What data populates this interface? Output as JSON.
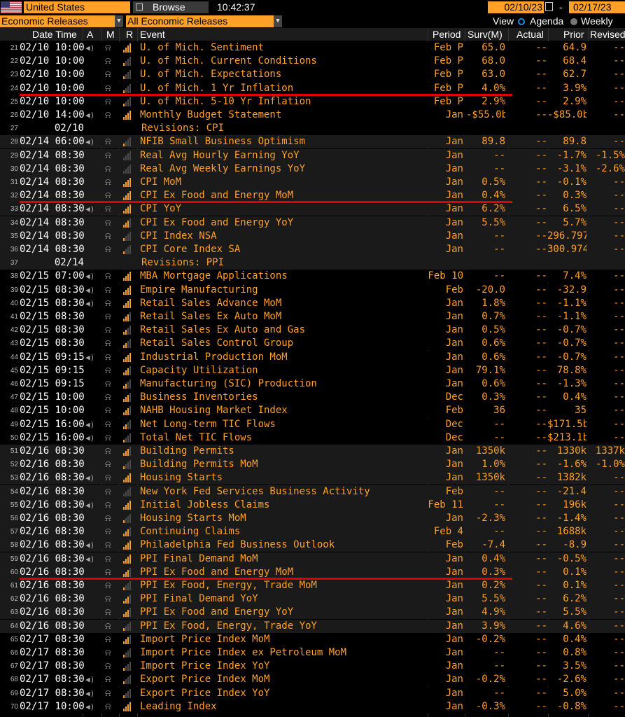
{
  "topbar": {
    "country": "United States",
    "browse_label": "Browse",
    "clock": "10:42:37",
    "start_date": "02/10/23",
    "dash": "-",
    "end_date": "02/17/23"
  },
  "filters": {
    "category": "Economic Releases",
    "releases": "All Economic Releases",
    "view_label": "View",
    "agenda_label": "Agenda",
    "weekly_label": "Weekly"
  },
  "columns": {
    "datetime": "Date Time",
    "a": "A",
    "m": "M",
    "r": "R",
    "event": "Event",
    "period": "Period",
    "surv": "Surv(M)",
    "actual": "Actual",
    "prior": "Prior",
    "revised": "Revised"
  },
  "colors": {
    "accent": "#ffa028",
    "highlight_line": "#e00000",
    "group_bg": "#1a1a1a"
  },
  "rows": [
    {
      "n": "21",
      "dt": "02/10 10:00",
      "a": true,
      "r": 4,
      "ev": "U. of Mich. Sentiment",
      "pd": "Feb P",
      "sv": "65.0",
      "ac": "--",
      "pr": "64.9",
      "rv": "--",
      "g": 1
    },
    {
      "n": "22",
      "dt": "02/10 10:00",
      "a": false,
      "r": 1,
      "ev": "U. of Mich. Current Conditions",
      "pd": "Feb P",
      "sv": "68.0",
      "ac": "--",
      "pr": "68.4",
      "rv": "--",
      "g": 1
    },
    {
      "n": "23",
      "dt": "02/10 10:00",
      "a": false,
      "r": 1,
      "ev": "U. of Mich. Expectations",
      "pd": "Feb P",
      "sv": "63.0",
      "ac": "--",
      "pr": "62.7",
      "rv": "--",
      "g": 1
    },
    {
      "n": "24",
      "dt": "02/10 10:00",
      "a": false,
      "r": 1,
      "ev": "U. of Mich. 1 Yr Inflation",
      "pd": "Feb P",
      "sv": "4.0%",
      "ac": "--",
      "pr": "3.9%",
      "rv": "--",
      "g": 1
    },
    {
      "n": "25",
      "dt": "02/10 10:00",
      "a": false,
      "r": 1,
      "ev": "U. of Mich. 5-10 Yr Inflation",
      "pd": "Feb P",
      "sv": "2.9%",
      "ac": "--",
      "pr": "2.9%",
      "rv": "--",
      "g": 1
    },
    {
      "n": "26",
      "dt": "02/10 14:00",
      "a": true,
      "r": 4,
      "ev": "Monthly Budget Statement",
      "pd": "Jan",
      "sv": "-$55.0b",
      "ac": "--",
      "pr": "-$85.0b",
      "rv": "--",
      "g": 1
    },
    {
      "n": "27",
      "dt": "02/10",
      "a": false,
      "r": 0,
      "ev": "Revisions: CPI",
      "pd": "",
      "sv": "",
      "ac": "",
      "pr": "",
      "rv": "",
      "g": 1,
      "rev": true
    },
    {
      "n": "28",
      "dt": "02/14 06:00",
      "a": true,
      "r": 1,
      "ev": "NFIB Small Business Optimism",
      "pd": "Jan",
      "sv": "89.8",
      "ac": "--",
      "pr": "89.8",
      "rv": "--",
      "g": 2
    },
    {
      "n": "29",
      "dt": "02/14 08:30",
      "a": false,
      "r": 0,
      "ev": "Real Avg Hourly Earning YoY",
      "pd": "Jan",
      "sv": "--",
      "ac": "--",
      "pr": "-1.7%",
      "rv": "-1.5%",
      "g": 2
    },
    {
      "n": "30",
      "dt": "02/14 08:30",
      "a": false,
      "r": 0,
      "ev": "Real Avg Weekly Earnings YoY",
      "pd": "Jan",
      "sv": "--",
      "ac": "--",
      "pr": "-3.1%",
      "rv": "-2.6%",
      "g": 2
    },
    {
      "n": "31",
      "dt": "02/14 08:30",
      "a": false,
      "r": 4,
      "ev": "CPI MoM",
      "pd": "Jan",
      "sv": "0.5%",
      "ac": "--",
      "pr": "-0.1%",
      "rv": "--",
      "g": 2
    },
    {
      "n": "32",
      "dt": "02/14 08:30",
      "a": false,
      "r": 4,
      "ev": "CPI Ex Food and Energy MoM",
      "pd": "Jan",
      "sv": "0.4%",
      "ac": "--",
      "pr": "0.3%",
      "rv": "--",
      "g": 2
    },
    {
      "n": "33",
      "dt": "02/14 08:30",
      "a": true,
      "r": 4,
      "ev": "CPI YoY",
      "pd": "Jan",
      "sv": "6.2%",
      "ac": "--",
      "pr": "6.5%",
      "rv": "--",
      "g": 2
    },
    {
      "n": "34",
      "dt": "02/14 08:30",
      "a": false,
      "r": 3,
      "ev": "CPI Ex Food and Energy YoY",
      "pd": "Jan",
      "sv": "5.5%",
      "ac": "--",
      "pr": "5.7%",
      "rv": "--",
      "g": 2
    },
    {
      "n": "35",
      "dt": "02/14 08:30",
      "a": false,
      "r": 1,
      "ev": "CPI Index NSA",
      "pd": "Jan",
      "sv": "--",
      "ac": "--",
      "pr": "296.797",
      "rv": "--",
      "g": 2
    },
    {
      "n": "36",
      "dt": "02/14 08:30",
      "a": false,
      "r": 1,
      "ev": "CPI Core Index SA",
      "pd": "Jan",
      "sv": "--",
      "ac": "--",
      "pr": "300.974",
      "rv": "--",
      "g": 2
    },
    {
      "n": "37",
      "dt": "02/14",
      "a": false,
      "r": 0,
      "ev": "Revisions: PPI",
      "pd": "",
      "sv": "",
      "ac": "",
      "pr": "",
      "rv": "",
      "g": 2,
      "rev": true
    },
    {
      "n": "38",
      "dt": "02/15 07:00",
      "a": true,
      "r": 4,
      "ev": "MBA Mortgage Applications",
      "pd": "Feb 10",
      "sv": "--",
      "ac": "--",
      "pr": "7.4%",
      "rv": "--",
      "g": 3
    },
    {
      "n": "39",
      "dt": "02/15 08:30",
      "a": true,
      "r": 4,
      "ev": "Empire Manufacturing",
      "pd": "Feb",
      "sv": "-20.0",
      "ac": "--",
      "pr": "-32.9",
      "rv": "--",
      "g": 3
    },
    {
      "n": "40",
      "dt": "02/15 08:30",
      "a": true,
      "r": 4,
      "ev": "Retail Sales Advance MoM",
      "pd": "Jan",
      "sv": "1.8%",
      "ac": "--",
      "pr": "-1.1%",
      "rv": "--",
      "g": 3
    },
    {
      "n": "41",
      "dt": "02/15 08:30",
      "a": false,
      "r": 3,
      "ev": "Retail Sales Ex Auto MoM",
      "pd": "Jan",
      "sv": "0.7%",
      "ac": "--",
      "pr": "-1.1%",
      "rv": "--",
      "g": 3
    },
    {
      "n": "42",
      "dt": "02/15 08:30",
      "a": false,
      "r": 2,
      "ev": "Retail Sales Ex Auto and Gas",
      "pd": "Jan",
      "sv": "0.5%",
      "ac": "--",
      "pr": "-0.7%",
      "rv": "--",
      "g": 3
    },
    {
      "n": "43",
      "dt": "02/15 08:30",
      "a": false,
      "r": 2,
      "ev": "Retail Sales Control Group",
      "pd": "Jan",
      "sv": "0.6%",
      "ac": "--",
      "pr": "-0.7%",
      "rv": "--",
      "g": 3
    },
    {
      "n": "44",
      "dt": "02/15 09:15",
      "a": true,
      "r": 4,
      "ev": "Industrial Production MoM",
      "pd": "Jan",
      "sv": "0.6%",
      "ac": "--",
      "pr": "-0.7%",
      "rv": "--",
      "g": 3
    },
    {
      "n": "45",
      "dt": "02/15 09:15",
      "a": false,
      "r": 3,
      "ev": "Capacity Utilization",
      "pd": "Jan",
      "sv": "79.1%",
      "ac": "--",
      "pr": "78.8%",
      "rv": "--",
      "g": 3
    },
    {
      "n": "46",
      "dt": "02/15 09:15",
      "a": false,
      "r": 2,
      "ev": "Manufacturing (SIC) Production",
      "pd": "Jan",
      "sv": "0.6%",
      "ac": "--",
      "pr": "-1.3%",
      "rv": "--",
      "g": 3
    },
    {
      "n": "47",
      "dt": "02/15 10:00",
      "a": false,
      "r": 3,
      "ev": "Business Inventories",
      "pd": "Dec",
      "sv": "0.3%",
      "ac": "--",
      "pr": "0.4%",
      "rv": "--",
      "g": 3
    },
    {
      "n": "48",
      "dt": "02/15 10:00",
      "a": false,
      "r": 3,
      "ev": "NAHB Housing Market Index",
      "pd": "Feb",
      "sv": "36",
      "ac": "--",
      "pr": "35",
      "rv": "--",
      "g": 3
    },
    {
      "n": "49",
      "dt": "02/15 16:00",
      "a": true,
      "r": 2,
      "ev": "Net Long-term TIC Flows",
      "pd": "Dec",
      "sv": "--",
      "ac": "--",
      "pr": "$171.5b",
      "rv": "--",
      "g": 3
    },
    {
      "n": "50",
      "dt": "02/15 16:00",
      "a": true,
      "r": 1,
      "ev": "Total Net TIC Flows",
      "pd": "Dec",
      "sv": "--",
      "ac": "--",
      "pr": "$213.1b",
      "rv": "--",
      "g": 3
    },
    {
      "n": "51",
      "dt": "02/16 08:30",
      "a": false,
      "r": 3,
      "ev": "Building Permits",
      "pd": "Jan",
      "sv": "1350k",
      "ac": "--",
      "pr": "1330k",
      "rv": "1337k",
      "g": 4
    },
    {
      "n": "52",
      "dt": "02/16 08:30",
      "a": false,
      "r": 1,
      "ev": "Building Permits MoM",
      "pd": "Jan",
      "sv": "1.0%",
      "ac": "--",
      "pr": "-1.6%",
      "rv": "-1.0%",
      "g": 4
    },
    {
      "n": "53",
      "dt": "02/16 08:30",
      "a": true,
      "r": 4,
      "ev": "Housing Starts",
      "pd": "Jan",
      "sv": "1350k",
      "ac": "--",
      "pr": "1382k",
      "rv": "--",
      "g": 4
    },
    {
      "n": "54",
      "dt": "02/16 08:30",
      "a": false,
      "r": 0,
      "ev": "New York Fed Services Business Activity",
      "pd": "Feb",
      "sv": "--",
      "ac": "--",
      "pr": "-21.4",
      "rv": "--",
      "g": 4
    },
    {
      "n": "55",
      "dt": "02/16 08:30",
      "a": true,
      "r": 4,
      "ev": "Initial Jobless Claims",
      "pd": "Feb 11",
      "sv": "--",
      "ac": "--",
      "pr": "196k",
      "rv": "--",
      "g": 4
    },
    {
      "n": "56",
      "dt": "02/16 08:30",
      "a": false,
      "r": 1,
      "ev": "Housing Starts MoM",
      "pd": "Jan",
      "sv": "-2.3%",
      "ac": "--",
      "pr": "-1.4%",
      "rv": "--",
      "g": 4
    },
    {
      "n": "57",
      "dt": "02/16 08:30",
      "a": false,
      "r": 3,
      "ev": "Continuing Claims",
      "pd": "Feb 4",
      "sv": "--",
      "ac": "--",
      "pr": "1688k",
      "rv": "--",
      "g": 4
    },
    {
      "n": "58",
      "dt": "02/16 08:30",
      "a": true,
      "r": 4,
      "ev": "Philadelphia Fed Business Outlook",
      "pd": "Feb",
      "sv": "-7.4",
      "ac": "--",
      "pr": "-8.9",
      "rv": "--",
      "g": 4
    },
    {
      "n": "59",
      "dt": "02/16 08:30",
      "a": true,
      "r": 4,
      "ev": "PPI Final Demand MoM",
      "pd": "Jan",
      "sv": "0.4%",
      "ac": "--",
      "pr": "-0.5%",
      "rv": "--",
      "g": 4
    },
    {
      "n": "60",
      "dt": "02/16 08:30",
      "a": false,
      "r": 3,
      "ev": "PPI Ex Food and Energy MoM",
      "pd": "Jan",
      "sv": "0.3%",
      "ac": "--",
      "pr": "0.1%",
      "rv": "--",
      "g": 4
    },
    {
      "n": "61",
      "dt": "02/16 08:30",
      "a": false,
      "r": 1,
      "ev": "PPI Ex Food, Energy, Trade MoM",
      "pd": "Jan",
      "sv": "0.2%",
      "ac": "--",
      "pr": "0.1%",
      "rv": "--",
      "g": 4
    },
    {
      "n": "62",
      "dt": "02/16 08:30",
      "a": false,
      "r": 3,
      "ev": "PPI Final Demand YoY",
      "pd": "Jan",
      "sv": "5.5%",
      "ac": "--",
      "pr": "6.2%",
      "rv": "--",
      "g": 4
    },
    {
      "n": "63",
      "dt": "02/16 08:30",
      "a": false,
      "r": 3,
      "ev": "PPI Ex Food and Energy YoY",
      "pd": "Jan",
      "sv": "4.9%",
      "ac": "--",
      "pr": "5.5%",
      "rv": "--",
      "g": 4
    },
    {
      "n": "64",
      "dt": "02/16 08:30",
      "a": false,
      "r": 1,
      "ev": "PPI Ex Food, Energy, Trade YoY",
      "pd": "Jan",
      "sv": "3.9%",
      "ac": "--",
      "pr": "4.6%",
      "rv": "--",
      "g": 4
    },
    {
      "n": "65",
      "dt": "02/17 08:30",
      "a": false,
      "r": 3,
      "ev": "Import Price Index MoM",
      "pd": "Jan",
      "sv": "-0.2%",
      "ac": "--",
      "pr": "0.4%",
      "rv": "--",
      "g": 5
    },
    {
      "n": "66",
      "dt": "02/17 08:30",
      "a": false,
      "r": 1,
      "ev": "Import Price Index ex Petroleum MoM",
      "pd": "Jan",
      "sv": "--",
      "ac": "--",
      "pr": "0.8%",
      "rv": "--",
      "g": 5
    },
    {
      "n": "67",
      "dt": "02/17 08:30",
      "a": false,
      "r": 1,
      "ev": "Import Price Index YoY",
      "pd": "Jan",
      "sv": "--",
      "ac": "--",
      "pr": "3.5%",
      "rv": "--",
      "g": 5
    },
    {
      "n": "68",
      "dt": "02/17 08:30",
      "a": true,
      "r": 1,
      "ev": "Export Price Index MoM",
      "pd": "Jan",
      "sv": "-0.2%",
      "ac": "--",
      "pr": "-2.6%",
      "rv": "--",
      "g": 5
    },
    {
      "n": "69",
      "dt": "02/17 08:30",
      "a": true,
      "r": 1,
      "ev": "Export Price Index YoY",
      "pd": "Jan",
      "sv": "--",
      "ac": "--",
      "pr": "5.0%",
      "rv": "--",
      "g": 5
    },
    {
      "n": "70",
      "dt": "02/17 10:00",
      "a": true,
      "r": 4,
      "ev": "Leading Index",
      "pd": "Jan",
      "sv": "-0.3%",
      "ac": "--",
      "pr": "-0.8%",
      "rv": "--",
      "g": 5
    }
  ],
  "highlighted_rows": [
    "24",
    "32",
    "60"
  ]
}
